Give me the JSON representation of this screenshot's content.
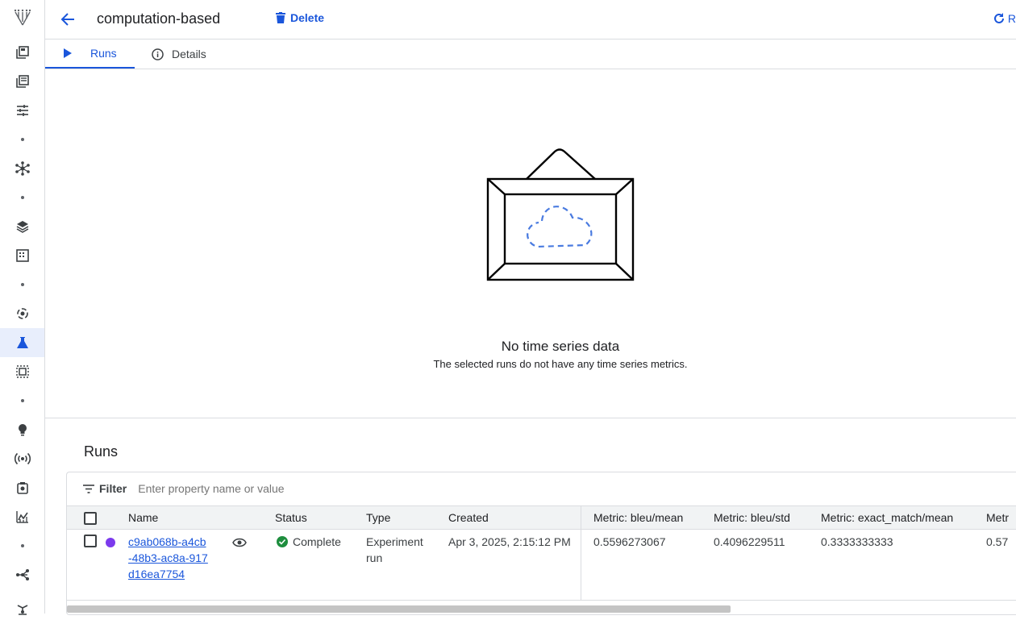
{
  "header": {
    "title": "computation-based",
    "delete_label": "Delete",
    "refresh_label": "R"
  },
  "tabs": [
    {
      "label": "Runs"
    },
    {
      "label": "Details"
    }
  ],
  "empty_state": {
    "title": "No time series data",
    "subtitle": "The selected runs do not have any time series metrics."
  },
  "runs_section": {
    "heading": "Runs",
    "filter_label": "Filter",
    "filter_placeholder": "Enter property name or value",
    "columns": [
      "Name",
      "Status",
      "Type",
      "Created",
      "Metric: bleu/mean",
      "Metric: bleu/std",
      "Metric: exact_match/mean",
      "Metr"
    ],
    "rows": [
      {
        "name": "c9ab068b-a4cb-48b3-ac8a-917d16ea7754",
        "status": "Complete",
        "type": "Experiment run",
        "created": "Apr 3, 2025, 2:15:12 PM",
        "bleu_mean": "0.5596273067",
        "bleu_std": "0.4096229511",
        "exact_match_mean": "0.3333333333",
        "next_metric": "0.57"
      }
    ]
  },
  "colors": {
    "accent": "#1a56db",
    "run_color": "#7c3aed",
    "status_ok": "#1e8e3e"
  }
}
